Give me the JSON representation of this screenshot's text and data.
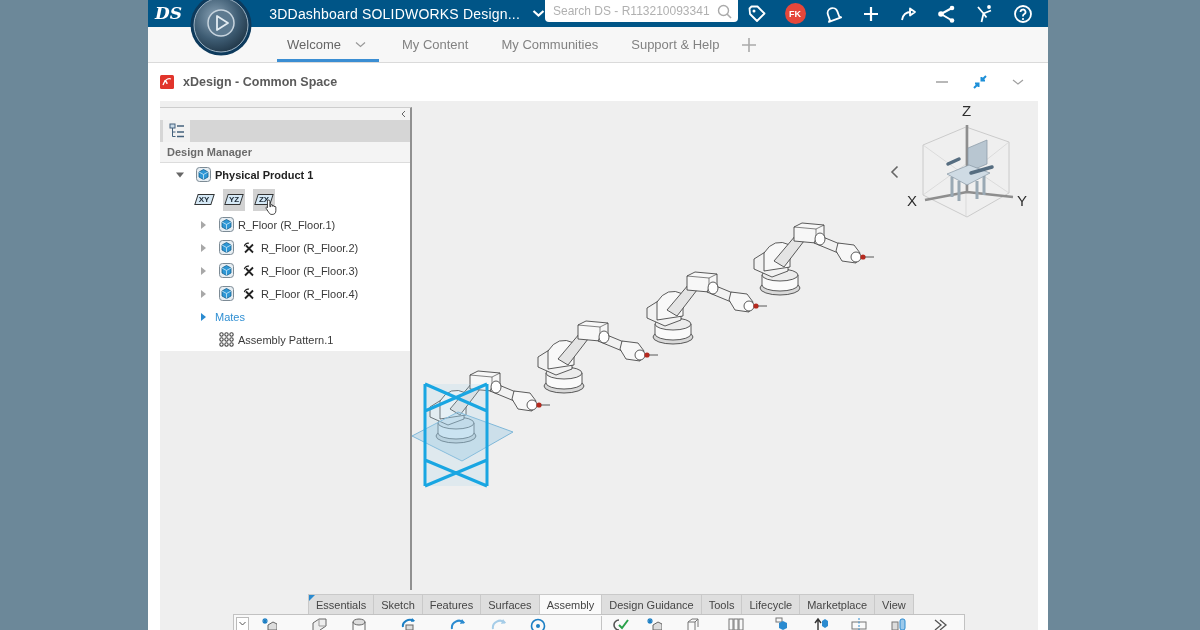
{
  "top_bar": {
    "logo": "DS",
    "title": "3DDashboard SOLIDWORKS Design...",
    "search": {
      "placeholder": "Search DS - R113210093341"
    },
    "user": {
      "initials": "FK"
    }
  },
  "tabs": [
    {
      "label": "Welcome",
      "selected": true,
      "menu": true
    },
    {
      "label": "My Content",
      "selected": false,
      "menu": false
    },
    {
      "label": "My Communities",
      "selected": false,
      "menu": false
    },
    {
      "label": "Support & Help",
      "selected": false,
      "menu": false
    }
  ],
  "app": {
    "title": "xDesign - Common Space"
  },
  "design_manager": {
    "title": "Design Manager",
    "tree": [
      {
        "kind": "product",
        "label": "Physical Product 1",
        "expanded": true,
        "planes": [
          {
            "label": "XY",
            "selected": false
          },
          {
            "label": "YZ",
            "selected": true
          },
          {
            "label": "ZX",
            "selected": true
          }
        ],
        "children": [
          {
            "kind": "part",
            "label": "R_Floor (R_Floor.1)",
            "expanded": false
          },
          {
            "kind": "instance",
            "label": "R_Floor (R_Floor.2)",
            "expanded": false
          },
          {
            "kind": "instance",
            "label": "R_Floor (R_Floor.3)",
            "expanded": false
          },
          {
            "kind": "instance",
            "label": "R_Floor (R_Floor.4)",
            "expanded": false
          },
          {
            "kind": "folder",
            "label": "Mates",
            "expanded": false
          },
          {
            "kind": "pattern",
            "label": "Assembly Pattern.1"
          }
        ]
      }
    ]
  },
  "view_cube": {
    "axes": [
      "Z",
      "X",
      "Y"
    ]
  },
  "command_tabs": [
    {
      "label": "Essentials",
      "selected": false,
      "pinned": true
    },
    {
      "label": "Sketch",
      "selected": false,
      "pinned": false
    },
    {
      "label": "Features",
      "selected": false,
      "pinned": false
    },
    {
      "label": "Surfaces",
      "selected": false,
      "pinned": false
    },
    {
      "label": "Assembly",
      "selected": true,
      "pinned": false
    },
    {
      "label": "Design Guidance",
      "selected": false,
      "pinned": false
    },
    {
      "label": "Tools",
      "selected": false,
      "pinned": false
    },
    {
      "label": "Lifecycle",
      "selected": false,
      "pinned": false
    },
    {
      "label": "Marketplace",
      "selected": false,
      "pinned": false
    },
    {
      "label": "View",
      "selected": false,
      "pinned": false
    }
  ]
}
